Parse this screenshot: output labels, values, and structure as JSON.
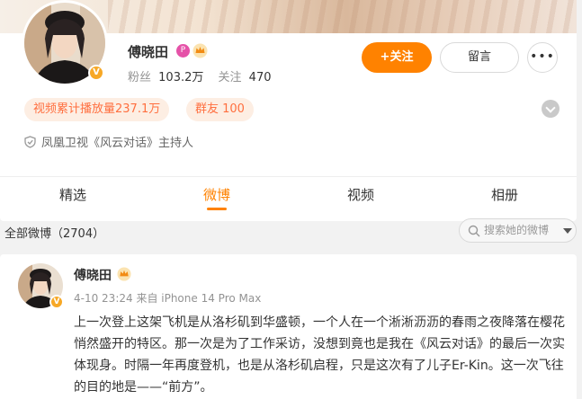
{
  "profile": {
    "name": "傅晓田",
    "fans_label": "粉丝",
    "fans_value": "103.2万",
    "follow_label": "关注",
    "follow_value": "470",
    "verified_mark": "V",
    "tag_icon_glyph": "P",
    "follow_button": "+关注",
    "message_button": "留言",
    "more_button": "•••",
    "play_count": "视频累计播放量237.1万",
    "group_friends": "群友 100",
    "intro": "凤凰卫视《风云对话》主持人"
  },
  "tabs": [
    {
      "label": "精选",
      "active": false
    },
    {
      "label": "微博",
      "active": true
    },
    {
      "label": "视频",
      "active": false
    },
    {
      "label": "相册",
      "active": false
    }
  ],
  "feed": {
    "all_label": "全部微博（2704）",
    "search_placeholder": "搜索她的微博"
  },
  "post": {
    "author": "傅晓田",
    "meta": "4-10 23:24  来自 iPhone 14 Pro Max",
    "body": "上一次登上这架飞机是从洛杉矶到华盛顿，一个人在一个淅淅沥沥的春雨之夜降落在樱花悄然盛开的特区。那一次是为了工作采访，没想到竟也是我在《风云对话》的最后一次实体现身。时隔一年再度登机，也是从洛杉矶启程，只是这次有了儿子Er-Kin。这一次飞往的目的地是——“前方”。"
  },
  "colors": {
    "accent": "#ff8200",
    "pill_bg": "#fdeee3",
    "pill_text": "#ff6f3f",
    "verified": "#f7a826"
  },
  "icons": {
    "verified": "verified-badge-icon",
    "crown": "crown-icon",
    "shield": "shield-icon",
    "search": "search-icon",
    "expand": "chevron-down-icon"
  }
}
